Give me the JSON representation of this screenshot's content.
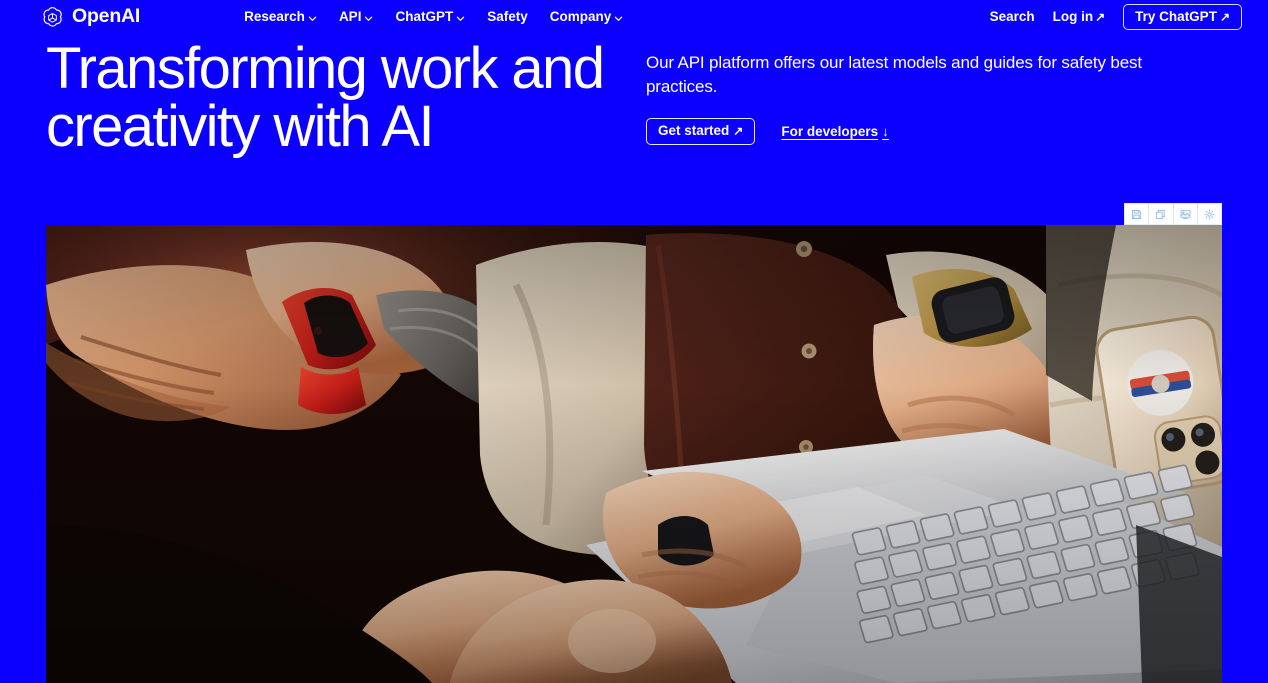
{
  "brand": {
    "name": "OpenAI",
    "logo_icon": "openai-blossom-icon"
  },
  "nav": {
    "items": [
      {
        "label": "Research",
        "has_dropdown": true,
        "icon": "chevron-down-icon"
      },
      {
        "label": "API",
        "has_dropdown": true,
        "icon": "chevron-down-icon"
      },
      {
        "label": "ChatGPT",
        "has_dropdown": true,
        "icon": "chevron-down-icon"
      },
      {
        "label": "Safety",
        "has_dropdown": false,
        "icon": ""
      },
      {
        "label": "Company",
        "has_dropdown": true,
        "icon": "chevron-down-icon"
      }
    ],
    "search_label": "Search",
    "login_label": "Log in",
    "login_arrow": "↗",
    "cta_label": "Try ChatGPT",
    "cta_arrow": "↗"
  },
  "hero": {
    "title": "Transforming work and\ncreativity with AI",
    "subtitle": "Our API platform offers our latest models and guides for safety best practices.",
    "primary_button": {
      "label": "Get started",
      "arrow": "↗"
    },
    "secondary_link": {
      "label": "For developers",
      "arrow": "↓"
    }
  },
  "image_toolbar": {
    "buttons": [
      {
        "name": "save-icon",
        "title": "Save"
      },
      {
        "name": "copy-icon",
        "title": "Copy"
      },
      {
        "name": "image-icon",
        "title": "Image"
      },
      {
        "name": "settings-gear-icon",
        "title": "Settings"
      }
    ]
  },
  "media": {
    "alt": "Two people working together on a silver laptop, one wearing a red smartwatch and a black ring, with a smartphone resting on a light cushion nearby"
  },
  "colors": {
    "background_blue": "#0b00ff",
    "text_white": "#ffffff",
    "toolbar_background": "#ffffff",
    "toolbar_icon": "#7fb4ef"
  }
}
